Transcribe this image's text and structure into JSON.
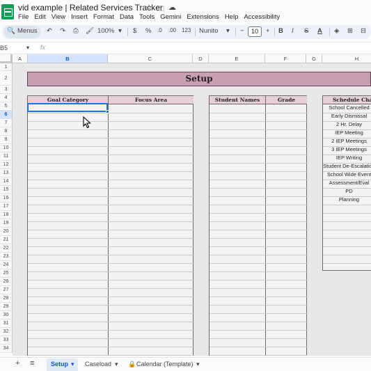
{
  "title_bar": {
    "doc_title": "vid example | Related Services Tracker",
    "icons": [
      "star-icon",
      "folder-icon",
      "cloud-icon"
    ]
  },
  "menu": [
    "File",
    "Edit",
    "View",
    "Insert",
    "Format",
    "Data",
    "Tools",
    "Gemini",
    "Extensions",
    "Help",
    "Accessibility"
  ],
  "toolbar": {
    "menus_label": "Menus",
    "zoom": "100%",
    "currency": "$",
    "percent": "%",
    "dec_decrease": ".0",
    "dec_increase": ".00",
    "number_format": "123",
    "font": "Nunito",
    "font_size": "10",
    "bold": "B",
    "italic": "I",
    "strike": "S",
    "text_color": "A"
  },
  "formula_bar": {
    "name_box": "B5",
    "fx": "fx"
  },
  "columns": [
    "A",
    "B",
    "C",
    "D",
    "E",
    "F",
    "G",
    "H"
  ],
  "selected_column": "B",
  "rows": [
    "1",
    "2",
    "3",
    "4",
    "5",
    "6",
    "7",
    "8",
    "9",
    "10",
    "11",
    "12",
    "13",
    "14",
    "15",
    "16",
    "17",
    "18",
    "19",
    "20",
    "21",
    "22",
    "23",
    "24",
    "25",
    "26",
    "27",
    "28",
    "29",
    "30",
    "31",
    "32",
    "33",
    "34"
  ],
  "selected_row": "6",
  "sheet": {
    "banner": "Setup",
    "goal_headers": [
      "Goal Category",
      "Focus Area"
    ],
    "student_headers": [
      "Student Names",
      "Grade"
    ],
    "schedule_header": "Schedule Changes",
    "schedule_items": [
      "School Cancelled",
      "Early Dismissal",
      "2 Hr. Delay",
      "IEP Meeting",
      "2 IEP Meetings",
      "3 IEP Meetings",
      "IEP Writing",
      "Student De-Escalation",
      "School Wide Event",
      "Assessment/Eval",
      "PD",
      "Planning"
    ]
  },
  "tabs": {
    "add": "+",
    "list": "≡",
    "items": [
      "Setup",
      "Caseload",
      "Calendar (Template)"
    ],
    "active": "Setup"
  }
}
